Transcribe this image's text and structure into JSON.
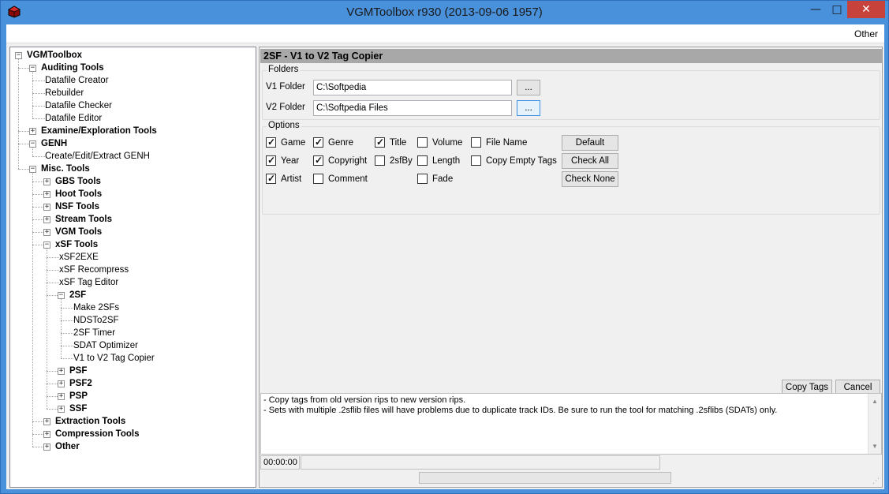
{
  "window": {
    "title": "VGMToolbox r930 (2013-09-06 1957)"
  },
  "menu": {
    "other": "Other"
  },
  "tree": [
    {
      "label": "VGMToolbox",
      "level": 0,
      "bold": true,
      "toggle": "-"
    },
    {
      "label": "Auditing Tools",
      "level": 1,
      "bold": true,
      "toggle": "-"
    },
    {
      "label": "Datafile Creator",
      "level": 2,
      "bold": false,
      "toggle": ""
    },
    {
      "label": "Rebuilder",
      "level": 2,
      "bold": false,
      "toggle": ""
    },
    {
      "label": "Datafile Checker",
      "level": 2,
      "bold": false,
      "toggle": ""
    },
    {
      "label": "Datafile Editor",
      "level": 2,
      "bold": false,
      "toggle": ""
    },
    {
      "label": "Examine/Exploration Tools",
      "level": 1,
      "bold": true,
      "toggle": "+"
    },
    {
      "label": "GENH",
      "level": 1,
      "bold": true,
      "toggle": "-"
    },
    {
      "label": "Create/Edit/Extract GENH",
      "level": 2,
      "bold": false,
      "toggle": ""
    },
    {
      "label": "Misc. Tools",
      "level": 1,
      "bold": true,
      "toggle": "-"
    },
    {
      "label": "GBS Tools",
      "level": 2,
      "bold": true,
      "toggle": "+"
    },
    {
      "label": "Hoot Tools",
      "level": 2,
      "bold": true,
      "toggle": "+"
    },
    {
      "label": "NSF Tools",
      "level": 2,
      "bold": true,
      "toggle": "+"
    },
    {
      "label": "Stream Tools",
      "level": 2,
      "bold": true,
      "toggle": "+"
    },
    {
      "label": "VGM Tools",
      "level": 2,
      "bold": true,
      "toggle": "+"
    },
    {
      "label": "xSF Tools",
      "level": 2,
      "bold": true,
      "toggle": "-"
    },
    {
      "label": "xSF2EXE",
      "level": 3,
      "bold": false,
      "toggle": ""
    },
    {
      "label": "xSF Recompress",
      "level": 3,
      "bold": false,
      "toggle": ""
    },
    {
      "label": "xSF Tag Editor",
      "level": 3,
      "bold": false,
      "toggle": ""
    },
    {
      "label": "2SF",
      "level": 3,
      "bold": true,
      "toggle": "-"
    },
    {
      "label": "Make 2SFs",
      "level": 4,
      "bold": false,
      "toggle": ""
    },
    {
      "label": "NDSTo2SF",
      "level": 4,
      "bold": false,
      "toggle": ""
    },
    {
      "label": "2SF Timer",
      "level": 4,
      "bold": false,
      "toggle": ""
    },
    {
      "label": "SDAT Optimizer",
      "level": 4,
      "bold": false,
      "toggle": ""
    },
    {
      "label": "V1 to V2 Tag Copier",
      "level": 4,
      "bold": false,
      "toggle": ""
    },
    {
      "label": "PSF",
      "level": 3,
      "bold": true,
      "toggle": "+"
    },
    {
      "label": "PSF2",
      "level": 3,
      "bold": true,
      "toggle": "+"
    },
    {
      "label": "PSP",
      "level": 3,
      "bold": true,
      "toggle": "+"
    },
    {
      "label": "SSF",
      "level": 3,
      "bold": true,
      "toggle": "+"
    },
    {
      "label": "Extraction Tools",
      "level": 2,
      "bold": true,
      "toggle": "+"
    },
    {
      "label": "Compression Tools",
      "level": 2,
      "bold": true,
      "toggle": "+"
    },
    {
      "label": "Other",
      "level": 2,
      "bold": true,
      "toggle": "+"
    }
  ],
  "panel": {
    "title": "2SF - V1 to V2 Tag Copier",
    "folders_label": "Folders",
    "v1_label": "V1 Folder",
    "v1_value": "C:\\Softpedia",
    "v2_label": "V2 Folder",
    "v2_value": "C:\\Softpedia Files",
    "browse": "...",
    "options_label": "Options",
    "checkboxes": [
      {
        "label": "Game",
        "checked": true
      },
      {
        "label": "Genre",
        "checked": true
      },
      {
        "label": "Title",
        "checked": true
      },
      {
        "label": "Volume",
        "checked": false
      },
      {
        "label": "File Name",
        "checked": false
      },
      {
        "label": "Year",
        "checked": true
      },
      {
        "label": "Copyright",
        "checked": true
      },
      {
        "label": "2sfBy",
        "checked": false
      },
      {
        "label": "Length",
        "checked": false
      },
      {
        "label": "Copy Empty Tags",
        "checked": false
      },
      {
        "label": "Artist",
        "checked": true
      },
      {
        "label": "Comment",
        "checked": false
      },
      {
        "label": "Fade",
        "checked": false
      }
    ],
    "btn_default": "Default",
    "btn_check_all": "Check All",
    "btn_check_none": "Check None",
    "btn_copy_tags": "Copy Tags",
    "btn_cancel": "Cancel",
    "log_line1": "- Copy tags from old version rips to new version rips.",
    "log_line2": "- Sets with multiple .2sflib files will have problems due to duplicate track IDs.  Be sure to run the tool for matching .2sflibs (SDATs) only.",
    "timer": "00:00:00"
  }
}
